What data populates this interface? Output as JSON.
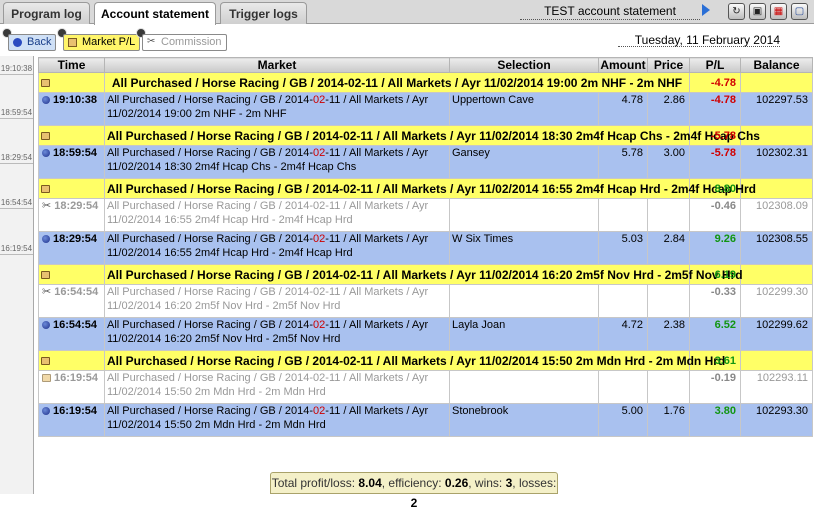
{
  "tabs": [
    {
      "label": "Program log",
      "active": false
    },
    {
      "label": "Account statement",
      "active": true
    },
    {
      "label": "Trigger logs",
      "active": false
    }
  ],
  "header": {
    "title": "TEST account statement",
    "icons": [
      "next-arrow-icon",
      "refresh-icon",
      "save-icon",
      "calendar-icon",
      "window-icon"
    ]
  },
  "toolbar": {
    "back_label": "Back",
    "market_pl_label": "Market P/L",
    "commission_label": "Commission",
    "date": "Tuesday, 11 February 2014"
  },
  "gutter_times": [
    "19:10:38",
    "18:59:54",
    "18:29:54",
    "16:54:54",
    "16:19:54"
  ],
  "columns": [
    "Time",
    "Market",
    "Selection",
    "Amount",
    "Price",
    "P/L",
    "Balance"
  ],
  "rows": [
    {
      "kind": "group",
      "market": "All Purchased / Horse Racing / GB / 2014-02-11 / All Markets / Ayr 11/02/2014 19:00 2m NHF - 2m NHF",
      "pl": "-4.78"
    },
    {
      "kind": "bet",
      "time": "19:10:38",
      "market_a": "All Purchased / Horse Racing / GB / 2014-",
      "market_mm": "02",
      "market_b": "-11 / All Markets / Ayr",
      "market_c": "11/02/2014 19:00 2m NHF - 2m NHF",
      "selection": "Uppertown Cave",
      "amount": "4.78",
      "price": "2.86",
      "pl": "-4.78",
      "balance": "102297.53"
    },
    {
      "kind": "group",
      "market": "All Purchased / Horse Racing / GB / 2014-02-11 / All Markets / Ayr 11/02/2014 18:30 2m4f Hcap Chs - 2m4f Hcap Chs",
      "pl": "-5.78"
    },
    {
      "kind": "bet",
      "time": "18:59:54",
      "market_a": "All Purchased / Horse Racing / GB / 2014-",
      "market_mm": "02",
      "market_b": "-11 / All Markets / Ayr",
      "market_c": "11/02/2014 18:30 2m4f Hcap Chs - 2m4f Hcap Chs",
      "selection": "Gansey",
      "amount": "5.78",
      "price": "3.00",
      "pl": "-5.78",
      "balance": "102302.31"
    },
    {
      "kind": "group",
      "market": "All Purchased / Horse Racing / GB / 2014-02-11 / All Markets / Ayr 11/02/2014 16:55 2m4f Hcap Hrd - 2m4f Hcap Hrd",
      "pl": "8.80"
    },
    {
      "kind": "comm",
      "time": "18:29:54",
      "market_a": "All Purchased / Horse Racing / GB / 2014-",
      "market_mm": "02",
      "market_b": "-11 / All Markets / Ayr",
      "market_c": "11/02/2014 16:55 2m4f Hcap Hrd - 2m4f Hcap Hrd",
      "selection": "",
      "amount": "",
      "price": "",
      "pl": "-0.46",
      "balance": "102308.09"
    },
    {
      "kind": "bet",
      "time": "18:29:54",
      "market_a": "All Purchased / Horse Racing / GB / 2014-",
      "market_mm": "02",
      "market_b": "-11 / All Markets / Ayr",
      "market_c": "11/02/2014 16:55 2m4f Hcap Hrd - 2m4f Hcap Hrd",
      "selection": "W Six Times",
      "amount": "5.03",
      "price": "2.84",
      "pl": "9.26",
      "balance": "102308.55"
    },
    {
      "kind": "group",
      "market": "All Purchased / Horse Racing / GB / 2014-02-11 / All Markets / Ayr 11/02/2014 16:20 2m5f Nov Hrd - 2m5f Nov Hrd",
      "pl": "6.19"
    },
    {
      "kind": "comm",
      "time": "16:54:54",
      "market_a": "All Purchased / Horse Racing / GB / 2014-",
      "market_mm": "02",
      "market_b": "-11 / All Markets / Ayr",
      "market_c": "11/02/2014 16:20 2m5f Nov Hrd - 2m5f Nov Hrd",
      "selection": "",
      "amount": "",
      "price": "",
      "pl": "-0.33",
      "balance": "102299.30"
    },
    {
      "kind": "bet",
      "time": "16:54:54",
      "market_a": "All Purchased / Horse Racing / GB / 2014-",
      "market_mm": "02",
      "market_b": "-11 / All Markets / Ayr",
      "market_c": "11/02/2014 16:20 2m5f Nov Hrd - 2m5f Nov Hrd",
      "selection": "Layla Joan",
      "amount": "4.72",
      "price": "2.38",
      "pl": "6.52",
      "balance": "102299.62"
    },
    {
      "kind": "group",
      "market": "All Purchased / Horse Racing / GB / 2014-02-11 / All Markets / Ayr 11/02/2014 15:50 2m Mdn Hrd - 2m Mdn Hrd",
      "pl": "3.61"
    },
    {
      "kind": "comm",
      "time": "16:19:54",
      "market_a": "All Purchased / Horse Racing / GB / 2014-",
      "market_mm": "02",
      "market_b": "-11 / All Markets / Ayr",
      "market_c": "11/02/2014 15:50 2m Mdn Hrd - 2m Mdn Hrd",
      "selection": "",
      "amount": "",
      "price": "",
      "pl": "-0.19",
      "balance": "102293.11"
    },
    {
      "kind": "bet",
      "time": "16:19:54",
      "market_a": "All Purchased / Horse Racing / GB / 2014-",
      "market_mm": "02",
      "market_b": "-11 / All Markets / Ayr",
      "market_c": "11/02/2014 15:50 2m Mdn Hrd - 2m Mdn Hrd",
      "selection": "Stonebrook",
      "amount": "5.00",
      "price": "1.76",
      "pl": "3.80",
      "balance": "102293.30"
    }
  ],
  "footer": {
    "profit_label": "Total profit/loss: ",
    "profit_value": "8.04",
    "eff_label": ", efficiency: ",
    "eff_value": "0.26",
    "wins_label": ", wins: ",
    "wins_value": "3",
    "losses_label": ", losses: ",
    "losses_value": "2"
  },
  "colors": {
    "group_row": "#ffff66",
    "bet_row": "#a9c1ef",
    "negative": "#d10000",
    "positive": "#119511"
  }
}
